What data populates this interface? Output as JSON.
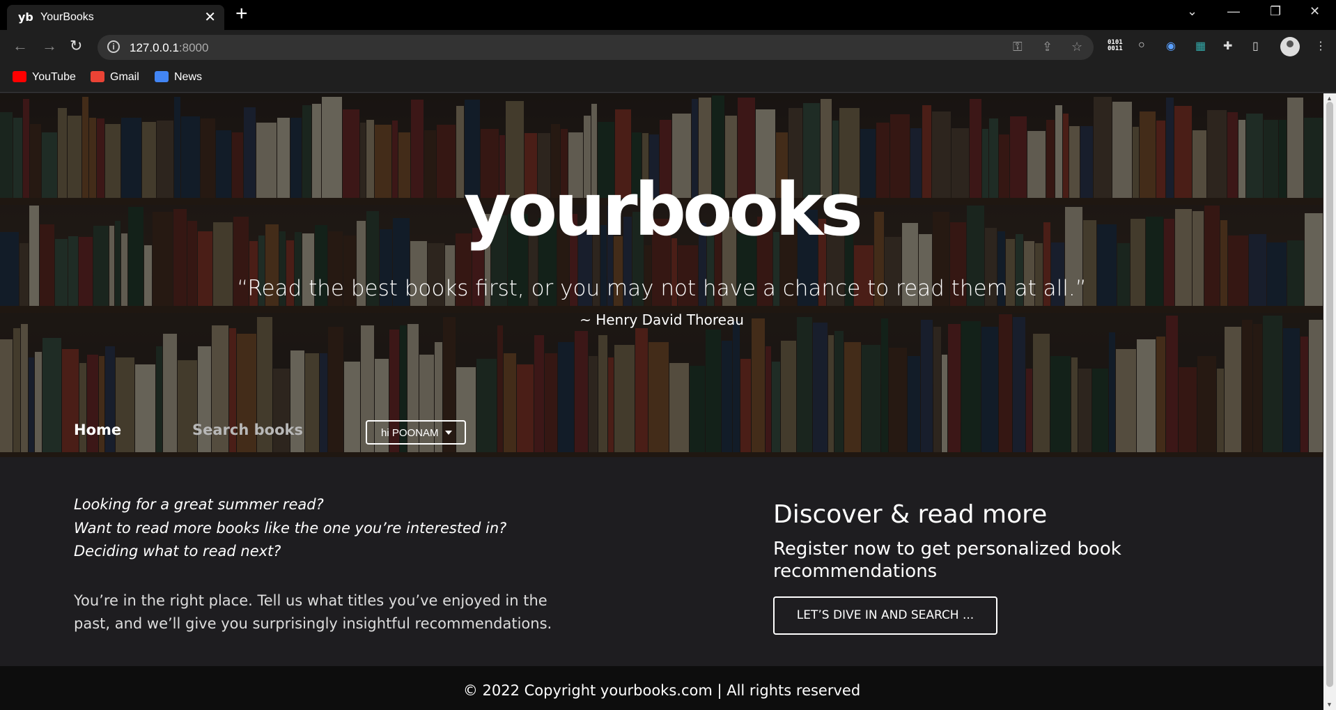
{
  "browser": {
    "tab_favicon": "yb",
    "tab_title": "YourBooks",
    "url_host": "127.0.0.1",
    "url_port": ":8000",
    "extension_binary": "0101\n0011",
    "bookmarks": [
      {
        "label": "YouTube",
        "icon": "youtube-icon",
        "color": "#ff0000"
      },
      {
        "label": "Gmail",
        "icon": "gmail-icon",
        "color": "#ea4335"
      },
      {
        "label": "News",
        "icon": "news-icon",
        "color": "#4285f4"
      }
    ]
  },
  "hero": {
    "logo": "yourbooks",
    "quote": "“Read the best books first, or you may not have a chance to read them at all.”",
    "author": "~ Henry David Thoreau"
  },
  "nav": {
    "home": "Home",
    "search": "Search books",
    "user_menu": "hi POONAM"
  },
  "intro": {
    "questions": [
      "Looking for a great summer read?",
      "Want to read more books like the one you’re interested in?",
      "Deciding what to read next?"
    ],
    "body": "You’re in the right place. Tell us what titles you’ve enjoyed in the past, and we’ll give you surprisingly insightful recommendations."
  },
  "discover": {
    "title": "Discover & read more",
    "subtitle": "Register now to get personalized book recommendations",
    "button": "LET’S DIVE IN AND SEARCH ..."
  },
  "footer": {
    "text": "© 2022 Copyright yourbooks.com | All rights reserved"
  }
}
